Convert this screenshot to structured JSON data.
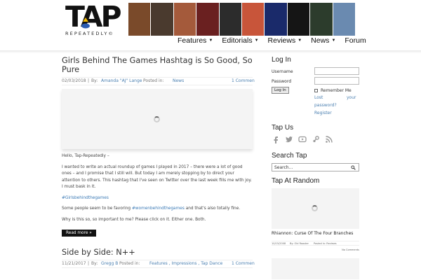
{
  "logo": {
    "name": "TAP",
    "tagline": "REPEATEDLY©"
  },
  "strip_colors": [
    "#7a4a2a",
    "#4a3a2e",
    "#a45a3b",
    "#6a2020",
    "#2c2c2c",
    "#c8553a",
    "#1a2a6a",
    "#151515",
    "#2c3c2c",
    "#6a8ab0"
  ],
  "nav": [
    {
      "label": "Features",
      "caret": "▼"
    },
    {
      "label": "Editorials",
      "caret": "▼"
    },
    {
      "label": "Reviews",
      "caret": "▼"
    },
    {
      "label": "News",
      "caret": "▼"
    },
    {
      "label": "Forum",
      "caret": ""
    }
  ],
  "post1": {
    "title": "Girls Behind The Games Hashtag is So Good, So Pure",
    "date": "02/03/2018",
    "by_label": "By:",
    "author": "Amanda \"AJ\" Lange",
    "posted_label": "Posted in:",
    "category": "News",
    "comments": "1 Commen",
    "p1": "Hello, Tap-Repeatedly –",
    "p2": "I wanted to write an actual roundup of games I played in 2017 – there were a lot of good ones – and I promise that I still will. But today I am merely stopping by to direct your attention to others. This hashtag that I've seen on Twitter over the last week fills me with joy. I must bask in it.",
    "tag1": "#Girlsbehindthegames",
    "p3a": "Some people seem to be favoring",
    "tag2": "#womenbehindthegames",
    "p3b": "and that's also totally fine.",
    "p4": "Why is this so, so important to me? Please click on it. Either one. Both.",
    "read_more": "Read more »"
  },
  "post2": {
    "title": "Side by Side: N++",
    "date": "11/21/2017",
    "by_label": "By:",
    "author": "Gregg B",
    "posted_label": "Posted in:",
    "categories": "Features , Impressions , Tap Dance",
    "comments": "1 Commen"
  },
  "sidebar": {
    "login_title": "Log In",
    "username_label": "Username",
    "password_label": "Password",
    "login_button": "Log In",
    "remember_me": "Remember Me",
    "lost_password_1": "Lost",
    "lost_password_2": "your",
    "lost_password_3": "password?",
    "register": "Register",
    "tapus_title": "Tap Us",
    "social_icons": [
      "facebook-icon",
      "twitter-icon",
      "youtube-icon",
      "steam-icon",
      "rss-icon"
    ],
    "search_title": "Search Tap",
    "search_placeholder": "Search...",
    "random_title": "Tap At Random",
    "random_post_title": "Rhiannon: Curse Of The Four Branches",
    "random_date": "10/15/2008",
    "random_by": "By: Old Rooster",
    "random_posted": "Posted in: Reviews",
    "random_comments": "No Comments"
  }
}
